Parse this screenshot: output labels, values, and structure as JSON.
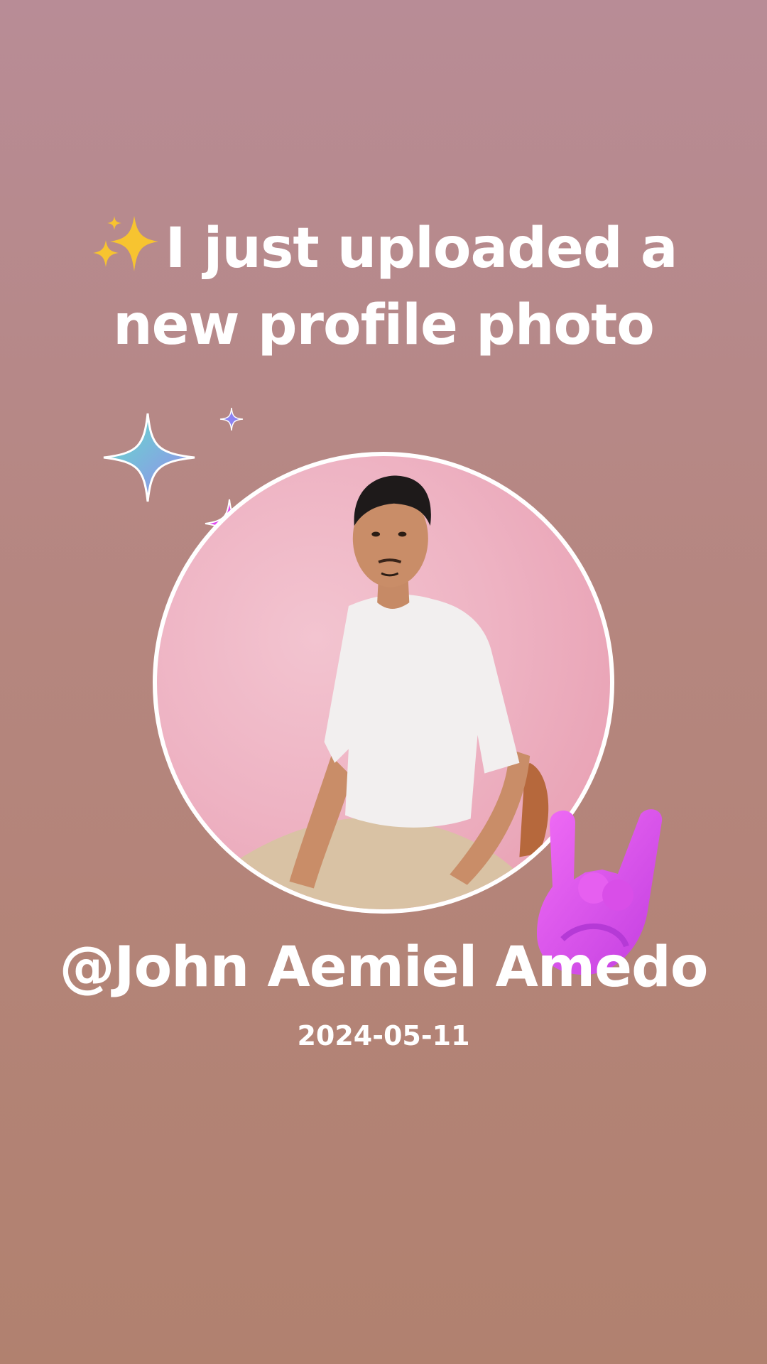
{
  "headline": {
    "emoji_icon": "sparkles-emoji-icon",
    "line1": "I just uploaded a",
    "line2": "new profile photo"
  },
  "profile": {
    "username": "@John Aemiel Amedo",
    "date": "2024-05-11"
  },
  "decorations": [
    "teal-sparkle-icon",
    "pink-sparkle-icon",
    "blue-sparkle-icon",
    "rock-hand-icon"
  ],
  "colors": {
    "background_top": "#b88c96",
    "background_bottom": "#b1816f",
    "text": "#ffffff",
    "photo_border": "#ffffff",
    "accent_pink": "#e04cf0"
  }
}
